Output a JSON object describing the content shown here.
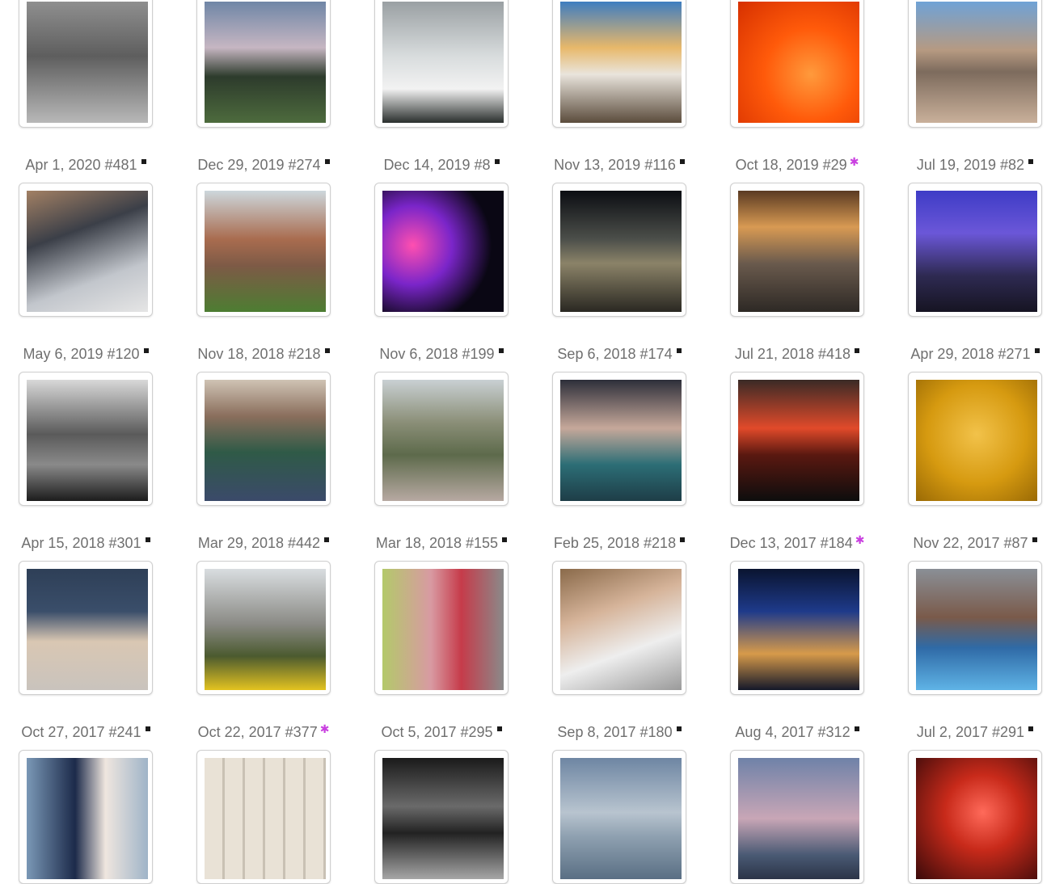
{
  "gallery": {
    "rows": [
      [
        {
          "date": "",
          "id": "",
          "mark": "none",
          "bg": "linear-gradient(180deg,#8f8f8f 0%,#5e5e5e 45%,#b8b8b8 100%)"
        },
        {
          "date": "",
          "id": "",
          "mark": "none",
          "bg": "linear-gradient(180deg,#6f86a6 0%,#c6b6c2 38%,#2d3b2c 62%,#4d6b3d 100%)"
        },
        {
          "date": "",
          "id": "",
          "mark": "none",
          "bg": "linear-gradient(180deg,#9aa0a3 0%,#d8dcdd 45%,#f2f2f2 72%,#2a2f2d 100%)"
        },
        {
          "date": "",
          "id": "",
          "mark": "none",
          "bg": "linear-gradient(180deg,#3f7dc0 0%,#e8b86a 38%,#e9e4dc 60%,#5b4c3c 100%)"
        },
        {
          "date": "",
          "id": "",
          "mark": "none",
          "bg": "radial-gradient(circle at 60% 60%,#ff9a3c 0%,#ff5a0a 45%,#d63000 100%)"
        },
        {
          "date": "",
          "id": "",
          "mark": "none",
          "bg": "linear-gradient(180deg,#6fa2d6 0%,#b69a82 40%,#7d6b5d 58%,#c9b09a 100%)"
        }
      ],
      [
        {
          "date": "Apr 1, 2020",
          "id": "#481",
          "mark": "square",
          "bg": "linear-gradient(160deg,#a28064 0%,#3b3f48 35%,#c2c6cc 70%,#e5e5e5 100%)"
        },
        {
          "date": "Dec 29, 2019",
          "id": "#274",
          "mark": "square",
          "bg": "linear-gradient(180deg,#cdd7dc 0%,#a96c4f 40%,#7d5a46 62%,#4d7d32 100%)"
        },
        {
          "date": "Dec 14, 2019",
          "id": "#8",
          "mark": "square",
          "bg": "radial-gradient(circle at 25% 45%,#ff4fb0 0%,#7a25c9 35%,#0a0714 70%)"
        },
        {
          "date": "Nov 13, 2019",
          "id": "#116",
          "mark": "square",
          "bg": "linear-gradient(180deg,#0b0d12 0%,#4c4f4a 40%,#8b8368 60%,#2a2822 100%)"
        },
        {
          "date": "Oct 18, 2019",
          "id": "#29",
          "mark": "fav",
          "bg": "linear-gradient(180deg,#5a3a22 0%,#d89a53 30%,#6a5a4d 60%,#2e2925 100%)"
        },
        {
          "date": "Jul 19, 2019",
          "id": "#82",
          "mark": "square",
          "bg": "linear-gradient(180deg,#3e3cc6 0%,#6b57d8 35%,#2e2a52 70%,#161422 100%)"
        }
      ],
      [
        {
          "date": "May 6, 2019",
          "id": "#120",
          "mark": "square",
          "bg": "linear-gradient(180deg,#d8d8d8 0%,#5a5a5a 45%,#8a8a8a 70%,#1c1c1c 100%)"
        },
        {
          "date": "Nov 18, 2018",
          "id": "#218",
          "mark": "square",
          "bg": "linear-gradient(180deg,#cfc3b4 0%,#8a6e5c 30%,#2f5a47 60%,#3b4a6a 100%)"
        },
        {
          "date": "Nov 6, 2018",
          "id": "#199",
          "mark": "square",
          "bg": "linear-gradient(180deg,#c9d0d3 0%,#8b8f78 35%,#5d6a4b 62%,#b7a9a2 100%)"
        },
        {
          "date": "Sep 6, 2018",
          "id": "#174",
          "mark": "square",
          "bg": "linear-gradient(180deg,#2d2f3a 0%,#c6a89a 40%,#2c6e76 70%,#1e3d47 100%)"
        },
        {
          "date": "Jul 21, 2018",
          "id": "#418",
          "mark": "square",
          "bg": "linear-gradient(180deg,#3a2a26 0%,#e14a2a 40%,#5a1810 62%,#0d0d0d 100%)"
        },
        {
          "date": "Apr 29, 2018",
          "id": "#271",
          "mark": "square",
          "bg": "radial-gradient(circle at 50% 45%,#f2c24a 0%,#d69a10 55%,#9a6a05 100%)"
        }
      ],
      [
        {
          "date": "Apr 15, 2018",
          "id": "#301",
          "mark": "square",
          "bg": "linear-gradient(180deg,#2e3f57 0%,#3a4e6a 35%,#d9c7b3 60%,#c9c3bd 100%)"
        },
        {
          "date": "Mar 29, 2018",
          "id": "#442",
          "mark": "square",
          "bg": "linear-gradient(180deg,#d9dde0 0%,#8b8b86 45%,#4b5a2f 72%,#e3c320 100%)"
        },
        {
          "date": "Mar 18, 2018",
          "id": "#155",
          "mark": "square",
          "bg": "linear-gradient(90deg,#b3c96a 0%,#d89aa2 40%,#c63b4a 65%,#8a8a8a 100%)"
        },
        {
          "date": "Feb 25, 2018",
          "id": "#218",
          "mark": "square",
          "bg": "linear-gradient(160deg,#8a6a4a 0%,#d6b49a 35%,#eeeeee 65%,#9a9a9a 100%)"
        },
        {
          "date": "Dec 13, 2017",
          "id": "#184",
          "mark": "fav",
          "bg": "linear-gradient(180deg,#0a1430 0%,#1e3a8a 35%,#d79a4a 70%,#14182a 100%)"
        },
        {
          "date": "Nov 22, 2017",
          "id": "#87",
          "mark": "square",
          "bg": "linear-gradient(180deg,#8a8f96 0%,#7a5a4a 40%,#2f6aa6 65%,#5fb3e6 100%)"
        }
      ],
      [
        {
          "date": "Oct 27, 2017",
          "id": "#241",
          "mark": "square",
          "bg": "linear-gradient(90deg,#7a98b6 0%,#1c2a4a 40%,#efe6df 65%,#9fb4c8 100%)"
        },
        {
          "date": "Oct 22, 2017",
          "id": "#377",
          "mark": "fav",
          "bg": "repeating-linear-gradient(90deg,#e9e2d6 0px,#e9e2d6 22px,#c9c1b4 22px,#c9c1b4 25px)"
        },
        {
          "date": "Oct 5, 2017",
          "id": "#295",
          "mark": "square",
          "bg": "linear-gradient(180deg,#1a1a1a 0%,#6a6a6a 40%,#222222 62%,#a6a6a6 100%)"
        },
        {
          "date": "Sep 8, 2017",
          "id": "#180",
          "mark": "square",
          "bg": "linear-gradient(180deg,#6e86a3 0%,#b8c4cf 45%,#8ea0b0 65%,#5a6f84 100%)"
        },
        {
          "date": "Aug 4, 2017",
          "id": "#312",
          "mark": "square",
          "bg": "linear-gradient(180deg,#6f82a8 0%,#c8a6b6 50%,#4a5a74 80%,#2c3448 100%)"
        },
        {
          "date": "Jul 2, 2017",
          "id": "#291",
          "mark": "square",
          "bg": "radial-gradient(circle at 55% 45%,#ff6a5a 0%,#c82a1a 40%,#3a0a0a 100%)"
        }
      ]
    ]
  }
}
